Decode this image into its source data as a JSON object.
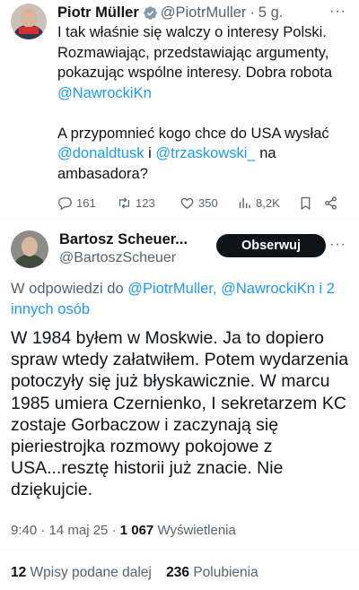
{
  "tweet": {
    "author_name": "Piotr Müller",
    "author_handle": "@PiotrMuller",
    "separator": "·",
    "time": "5 g.",
    "more": "···",
    "text_1": "I tak właśnie się walczy o interesy Polski. Rozmawiając, przedstawiając argumenty, pokazując wspólne interesy. Dobra robota ",
    "mention_nawrocki": "@NawrockiKn",
    "text_2": "A przypomnieć kogo chce do USA wysłać ",
    "mention_tusk": "@donaldtusk",
    "text_and": " i ",
    "mention_trzaskowski": "@trzaskowski_",
    "text_3": " na ambasadora?",
    "replies": "161",
    "reposts": "123",
    "likes": "350",
    "views": "8,2K"
  },
  "reply": {
    "author_name": "Bartosz Scheuer...",
    "author_handle": "@BartoszScheuer",
    "follow_label": "Obserwuj",
    "more": "···",
    "replying_prefix": "W odpowiedzi do ",
    "replying_names": "@PiotrMuller, @NawrockiKn i 2 innych osób",
    "text": "W 1984 byłem w Moskwie. Ja to dopiero spraw wtedy załatwiłem. Potem wydarzenia potoczyły się już błyskawicznie. W marcu 1985 umiera Czernienko, I sekretarzem KC zostaje Gorbaczow i zaczynają się pieriestrojka rozmowy pokojowe z USA...resztę historii już znacie. Nie dziękujcie.",
    "time_date": "9:40 · 14 maj 25 · ",
    "views_count": "1 067",
    "views_label": " Wyświetlenia",
    "reposts_count": "12",
    "reposts_label": " Wpisy podane dalej",
    "likes_count": "236",
    "likes_label": " Polubienia"
  },
  "colors": {
    "link": "#1d9bf0",
    "muted": "#536471",
    "text": "#0f1419",
    "follow_button": "#0f1419"
  },
  "icons": [
    "verified-badge-icon",
    "more-icon",
    "reply-icon",
    "repost-icon",
    "like-icon",
    "views-icon",
    "bookmark-icon",
    "share-icon"
  ]
}
